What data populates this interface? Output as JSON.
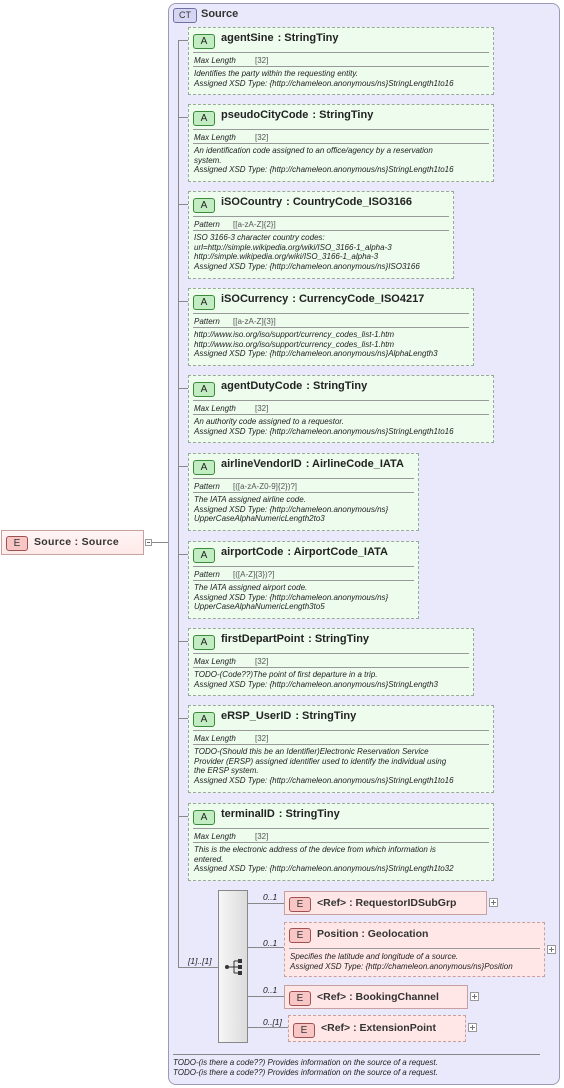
{
  "root": {
    "badge": "E",
    "label": "Source  : Source"
  },
  "complex_type": {
    "badge": "CT",
    "title": "Source"
  },
  "attributes": [
    {
      "name": "agentSine",
      "type": "StringTiny",
      "facet": "Max Length",
      "facet_value": "[32]",
      "doc": [
        "Identifies the party within the requesting entity.",
        "Assigned XSD Type: {http://chameleon.anonymous/ns}StringLength1to16"
      ]
    },
    {
      "name": "pseudoCityCode",
      "type": "StringTiny",
      "facet": "Max Length",
      "facet_value": "[32]",
      "doc": [
        "An identification code assigned to an office/agency by a reservation",
        "system.",
        "Assigned XSD Type: {http://chameleon.anonymous/ns}StringLength1to16"
      ]
    },
    {
      "name": "iSOCountry",
      "type": "CountryCode_ISO3166",
      "facet": "Pattern",
      "facet_value": "[[a-zA-Z]{2}]",
      "doc": [
        "ISO 3166-3 character country codes:",
        "url=http://simple.wikipedia.org/wiki/ISO_3166-1_alpha-3",
        "http://simple.wikipedia.org/wiki/ISO_3166-1_alpha-3",
        "Assigned XSD Type: {http://chameleon.anonymous/ns}ISO3166"
      ]
    },
    {
      "name": "iSOCurrency",
      "type": "CurrencyCode_ISO4217",
      "facet": "Pattern",
      "facet_value": "[[a-zA-Z]{3}]",
      "doc": [
        "http://www.iso.org/iso/support/currency_codes_list-1.htm",
        "http://www.iso.org/iso/support/currency_codes_list-1.htm",
        "Assigned XSD Type: {http://chameleon.anonymous/ns}AlphaLength3"
      ]
    },
    {
      "name": "agentDutyCode",
      "type": "StringTiny",
      "facet": "Max Length",
      "facet_value": "[32]",
      "doc": [
        "An authority code assigned to a requestor.",
        "Assigned XSD Type: {http://chameleon.anonymous/ns}StringLength1to16"
      ]
    },
    {
      "name": "airlineVendorID",
      "type": "AirlineCode_IATA",
      "facet": "Pattern",
      "facet_value": "[([a-zA-Z0-9]{2})?]",
      "doc": [
        "The IATA assigned airline code.",
        "Assigned XSD Type: {http://chameleon.anonymous/ns}",
        "UpperCaseAlphaNumericLength2to3"
      ]
    },
    {
      "name": "airportCode",
      "type": "AirportCode_IATA",
      "facet": "Pattern",
      "facet_value": "[([A-Z]{3})?]",
      "doc": [
        "The IATA assigned airport code.",
        "Assigned XSD Type: {http://chameleon.anonymous/ns}",
        "UpperCaseAlphaNumericLength3to5"
      ]
    },
    {
      "name": "firstDepartPoint",
      "type": "StringTiny",
      "facet": "Max Length",
      "facet_value": "[32]",
      "doc": [
        "TODO-(Code??)The point of first departure in a trip.",
        "Assigned XSD Type: {http://chameleon.anonymous/ns}StringLength3"
      ]
    },
    {
      "name": "eRSP_UserID",
      "type": "StringTiny",
      "facet": "Max Length",
      "facet_value": "[32]",
      "doc": [
        "TODO-(Should this be an Identifier)Electronic Reservation Service",
        "Provider (ERSP) assigned identifier used to identify the individual using",
        "the ERSP system.",
        "Assigned XSD Type: {http://chameleon.anonymous/ns}StringLength1to16"
      ]
    },
    {
      "name": "terminalID",
      "type": "StringTiny",
      "facet": "Max Length",
      "facet_value": "[32]",
      "doc": [
        "This is the electronic address of the device from which information is",
        "entered.",
        "Assigned XSD Type: {http://chameleon.anonymous/ns}StringLength1to32"
      ]
    }
  ],
  "attribute_badge": "A",
  "sequence": {
    "cardinality": "[1]..[1]"
  },
  "children": [
    {
      "card": "0..1",
      "badge": "E",
      "label": "<Ref>     : RequestorIDSubGrp"
    },
    {
      "card": "0..1",
      "badge": "E",
      "label": "Position  : Geolocation",
      "doc": [
        "Specifies the latitude and longitude of a source.",
        "Assigned XSD Type: {http://chameleon.anonymous/ns}Position"
      ]
    },
    {
      "card": "0..1",
      "badge": "E",
      "label": "<Ref>     : BookingChannel"
    },
    {
      "card": "0..[1]",
      "badge": "E",
      "label": "<Ref>     : ExtensionPoint"
    }
  ],
  "footer": [
    "TODO-(is there a code??) Provides information on the source of a request.",
    "TODO-(is there a code??) Provides information on the source of a request."
  ],
  "colors": {
    "attribute_bg": "#eefcee",
    "element_bg": "#ffe7e7",
    "complex_type_bg": "#e9e9fb"
  }
}
